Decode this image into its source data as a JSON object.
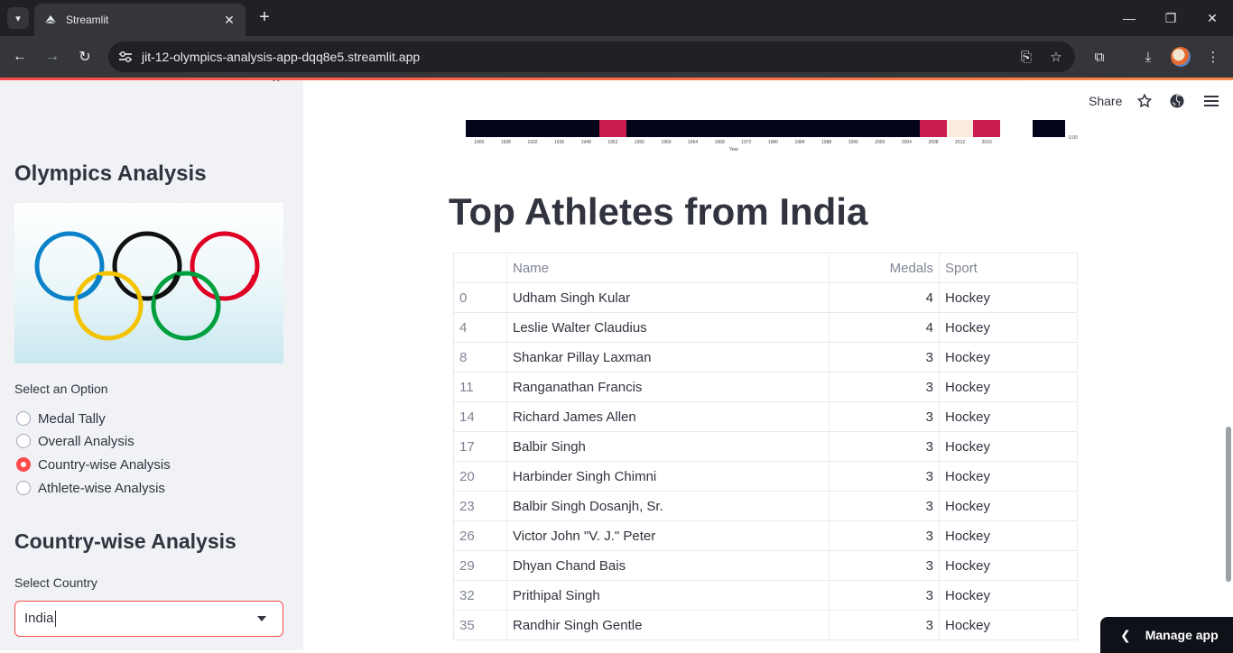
{
  "browser": {
    "tab_title": "Streamlit",
    "url": "jit-12-olympics-analysis-app-dqq8e5.streamlit.app"
  },
  "sidebar": {
    "title": "Olympics Analysis",
    "select_label": "Select an Option",
    "options": [
      {
        "label": "Medal Tally",
        "selected": false
      },
      {
        "label": "Overall Analysis",
        "selected": false
      },
      {
        "label": "Country-wise Analysis",
        "selected": true
      },
      {
        "label": "Athlete-wise Analysis",
        "selected": false
      }
    ],
    "section_title": "Country-wise Analysis",
    "country_label": "Select Country",
    "country_value": "India"
  },
  "header": {
    "share": "Share"
  },
  "heatmap": {
    "years": [
      "1900",
      "1928",
      "1932",
      "1936",
      "1948",
      "1952",
      "1956",
      "1960",
      "1964",
      "1968",
      "1972",
      "1980",
      "1984",
      "1988",
      "1996",
      "2000",
      "2004",
      "2008",
      "2012",
      "2016"
    ],
    "xlabel": "Year",
    "colorbar_label": "0.00",
    "colors": {
      "low": "#03051a",
      "mid": "#cb1b4f",
      "high": "#faebdd"
    }
  },
  "main": {
    "heading": "Top Athletes from India",
    "columns": [
      "",
      "Name",
      "Medals",
      "Sport"
    ],
    "rows": [
      {
        "idx": "0",
        "name": "Udham Singh Kular",
        "medals": "4",
        "sport": "Hockey"
      },
      {
        "idx": "4",
        "name": "Leslie Walter Claudius",
        "medals": "4",
        "sport": "Hockey"
      },
      {
        "idx": "8",
        "name": "Shankar Pillay Laxman",
        "medals": "3",
        "sport": "Hockey"
      },
      {
        "idx": "11",
        "name": "Ranganathan Francis",
        "medals": "3",
        "sport": "Hockey"
      },
      {
        "idx": "14",
        "name": "Richard James Allen",
        "medals": "3",
        "sport": "Hockey"
      },
      {
        "idx": "17",
        "name": "Balbir Singh",
        "medals": "3",
        "sport": "Hockey"
      },
      {
        "idx": "20",
        "name": "Harbinder Singh Chimni",
        "medals": "3",
        "sport": "Hockey"
      },
      {
        "idx": "23",
        "name": "Balbir Singh Dosanjh, Sr.",
        "medals": "3",
        "sport": "Hockey"
      },
      {
        "idx": "26",
        "name": "Victor John \"V. J.\" Peter",
        "medals": "3",
        "sport": "Hockey"
      },
      {
        "idx": "29",
        "name": "Dhyan Chand Bais",
        "medals": "3",
        "sport": "Hockey"
      },
      {
        "idx": "32",
        "name": "Prithipal Singh",
        "medals": "3",
        "sport": "Hockey"
      },
      {
        "idx": "35",
        "name": "Randhir Singh Gentle",
        "medals": "3",
        "sport": "Hockey"
      }
    ]
  },
  "footer": {
    "manage_app": "Manage app"
  },
  "colors": {
    "accent": "#ff4b4b",
    "sidebar_bg": "#f0f2f6",
    "text": "#31333f"
  }
}
